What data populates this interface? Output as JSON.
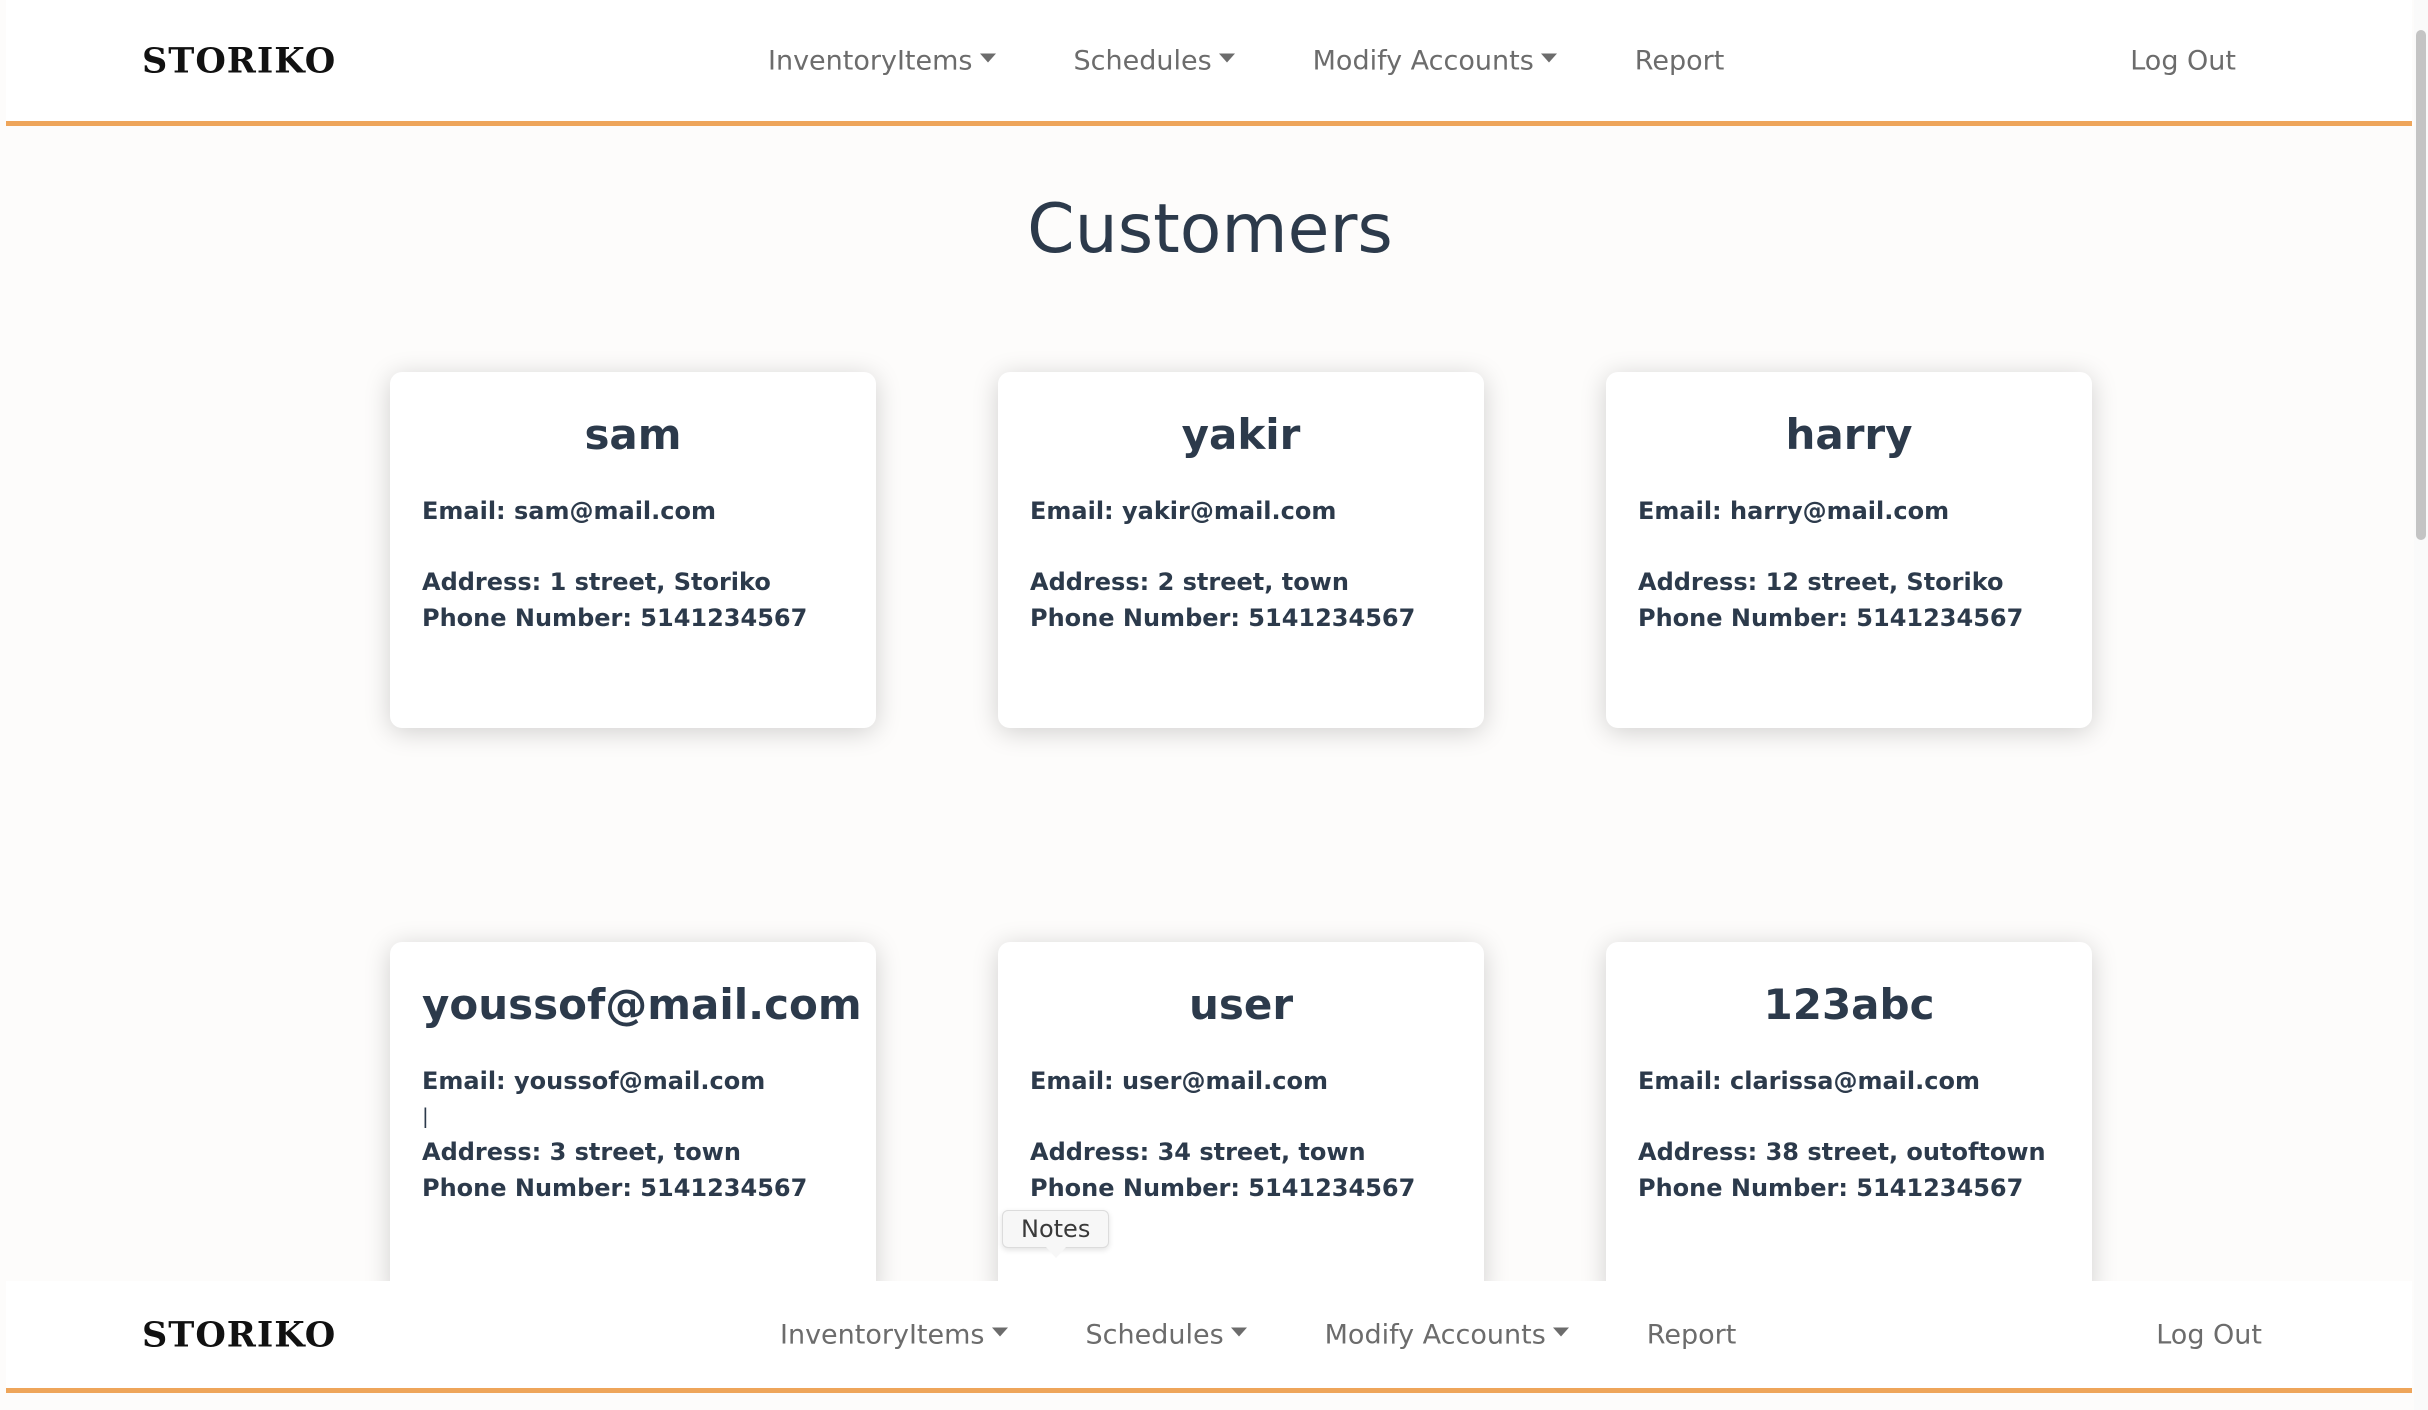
{
  "nav": {
    "brand": "STORIKO",
    "items": [
      {
        "label": "InventoryItems",
        "has_dropdown": true
      },
      {
        "label": "Schedules",
        "has_dropdown": true
      },
      {
        "label": "Modify Accounts",
        "has_dropdown": true
      },
      {
        "label": "Report",
        "has_dropdown": false
      }
    ],
    "logout": "Log Out",
    "accent_color": "#eea55a"
  },
  "page": {
    "title": "Customers"
  },
  "customers": [
    {
      "name": "sam",
      "email": "Email: sam@mail.com",
      "extra": "",
      "address": "Address: 1 street, Storiko",
      "phone": "Phone Number: 5141234567"
    },
    {
      "name": "yakir",
      "email": "Email: yakir@mail.com",
      "extra": "",
      "address": "Address: 2 street, town",
      "phone": "Phone Number: 5141234567"
    },
    {
      "name": "harry",
      "email": "Email: harry@mail.com",
      "extra": "",
      "address": "Address: 12 street, Storiko",
      "phone": "Phone Number: 5141234567"
    },
    {
      "name": "youssof@mail.com",
      "email": "Email: youssof@mail.com",
      "extra": "|",
      "address": "Address: 3 street, town",
      "phone": "Phone Number: 5141234567"
    },
    {
      "name": "user",
      "email": "Email: user@mail.com",
      "extra": "",
      "address": "Address: 34 street, town",
      "phone": "Phone Number: 5141234567"
    },
    {
      "name": "123abc",
      "email": "Email: clarissa@mail.com",
      "extra": "",
      "address": "Address: 38 street, outoftown",
      "phone": "Phone Number: 5141234567"
    }
  ],
  "tooltip": {
    "text": "Notes"
  }
}
